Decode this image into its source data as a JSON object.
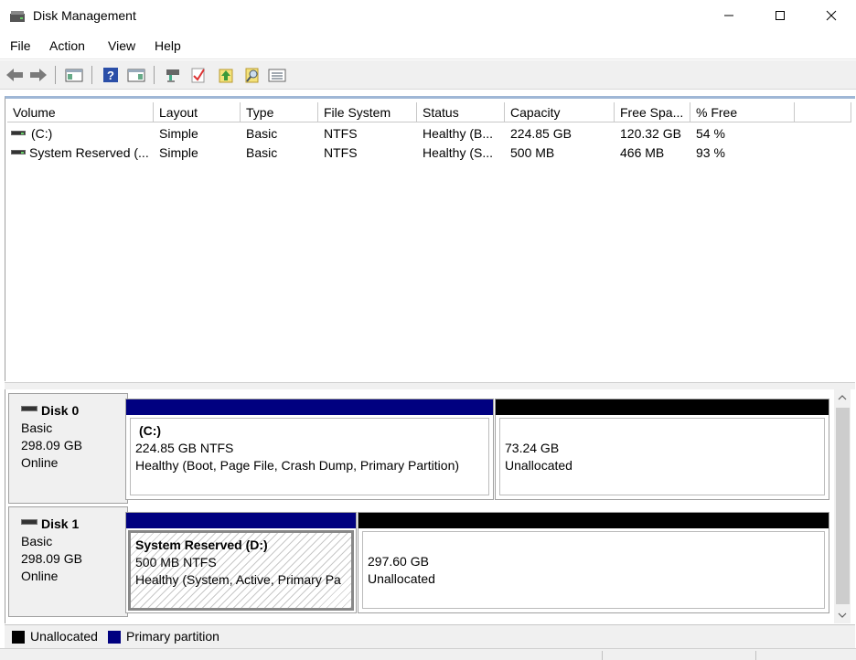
{
  "window": {
    "title": "Disk Management"
  },
  "menu": [
    "File",
    "Action",
    "View",
    "Help"
  ],
  "toolbar_icons": [
    "back-icon",
    "forward-icon",
    "console-tree-icon",
    "help-icon",
    "properties-pane-icon",
    "connect-icon",
    "checkmark-icon",
    "import-icon",
    "search-icon",
    "list-view-icon"
  ],
  "volume_list": {
    "columns": [
      "Volume",
      "Layout",
      "Type",
      "File System",
      "Status",
      "Capacity",
      "Free Spa...",
      "% Free"
    ],
    "rows": [
      {
        "volume": "(C:)",
        "layout": "Simple",
        "type": "Basic",
        "fs": "NTFS",
        "status": "Healthy (B...",
        "capacity": "224.85 GB",
        "free": "120.32 GB",
        "pct": "54 %"
      },
      {
        "volume": "System Reserved (...",
        "layout": "Simple",
        "type": "Basic",
        "fs": "NTFS",
        "status": "Healthy (S...",
        "capacity": "500 MB",
        "free": "466 MB",
        "pct": "93 %"
      }
    ]
  },
  "disks": [
    {
      "name": "Disk 0",
      "type": "Basic",
      "size": "298.09 GB",
      "status": "Online",
      "partitions": [
        {
          "title": "(C:)",
          "size": "224.85 GB NTFS",
          "status": "Healthy (Boot, Page File, Crash Dump, Primary Partition)"
        },
        {
          "title": "",
          "size": "73.24 GB",
          "status": "Unallocated"
        }
      ]
    },
    {
      "name": "Disk 1",
      "type": "Basic",
      "size": "298.09 GB",
      "status": "Online",
      "partitions": [
        {
          "title": "System Reserved  (D:)",
          "size": "500 MB NTFS",
          "status": "Healthy (System, Active, Primary Pa"
        },
        {
          "title": "",
          "size": "297.60 GB",
          "status": "Unallocated"
        }
      ]
    }
  ],
  "legend": [
    {
      "label": "Unallocated",
      "color": "#000000"
    },
    {
      "label": "Primary partition",
      "color": "#000080"
    }
  ],
  "colors": {
    "primary_bar": "#000080",
    "unallocated_bar": "#000000",
    "splitter": "#9fb7d6"
  }
}
